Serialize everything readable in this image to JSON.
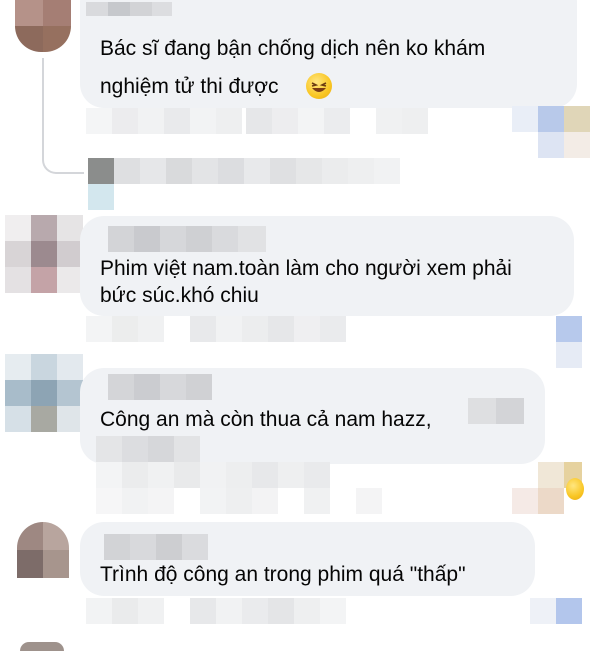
{
  "comments": [
    {
      "name_fragment": "Tôi thì",
      "text_lines": [
        "Bác sĩ đang bận chống dịch nên ko khám",
        "nghiệm tử thi được"
      ],
      "emoji": "laughing-face"
    },
    {
      "text_lines": [
        "Phim việt nam.toàn làm cho người xem phải",
        "bức súc.khó chiu"
      ]
    },
    {
      "text_lines": [
        "Công an mà còn thua cả nam hazz,"
      ]
    },
    {
      "text_lines": [
        "Trình độ công an trong phim quá \"thấp\""
      ]
    }
  ],
  "colors": {
    "bubble": "#f0f2f5",
    "text": "#050505"
  }
}
